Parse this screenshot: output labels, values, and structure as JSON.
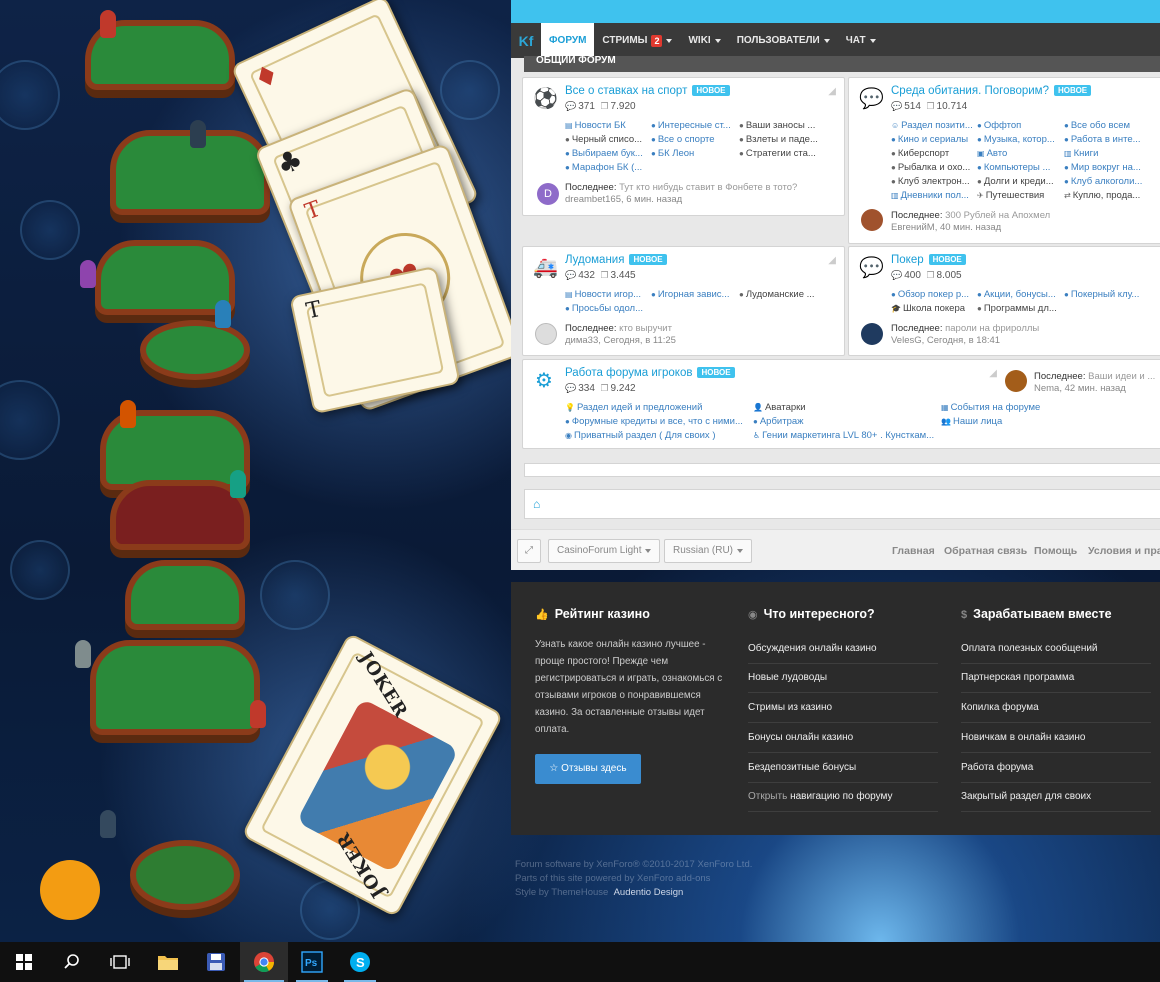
{
  "navbar": {
    "logo": "Kf",
    "items": [
      {
        "label": "ФОРУМ",
        "active": true
      },
      {
        "label": "СТРИМЫ",
        "badge": "2"
      },
      {
        "label": "WIKI"
      },
      {
        "label": "ПОЛЬЗОВАТЕЛИ"
      },
      {
        "label": "ЧАТ"
      }
    ]
  },
  "section_title": "ОБЩИЙ ФОРУМ",
  "new_badge": "НОВОЕ",
  "last_label": "Последнее:",
  "forums": {
    "sport": {
      "title": "Все о ставках на спорт",
      "threads": "371",
      "posts": "7.920",
      "subs": [
        "Новости БК",
        "Интересные ст...",
        "Ваши заносы ...",
        "Черный списо...",
        "Все о спорте",
        "Взлеты и паде...",
        "Выбираем бук...",
        "БК Леон",
        "Стратегии ста...",
        "Марафон БК (..."
      ],
      "last_title": "Тут кто нибудь ставит в Фонбете в тото?",
      "last_meta": "dreambet165, 6 мин. назад",
      "avatar_letter": "D"
    },
    "habitat": {
      "title": "Среда обитания. Поговорим?",
      "threads": "514",
      "posts": "10.714",
      "subs": [
        "Раздел позити...",
        "Оффтоп",
        "Все обо всем",
        "Кино и сериалы",
        "Музыка, котор...",
        "Работа в инте...",
        "Киберспорт",
        "Авто",
        "Книги",
        "Рыбалка и охо...",
        "Компьютеры ...",
        "Мир вокруг на...",
        "Клуб электрон...",
        "Долги и креди...",
        "Клуб алкоголи...",
        "Дневники пол...",
        "Путешествия",
        "Куплю, прода..."
      ],
      "last_title": "300 Рублей на Апохмел",
      "last_meta": "ЕвгенийМ, 40 мин. назад"
    },
    "ludomania": {
      "title": "Лудомания",
      "threads": "432",
      "posts": "3.445",
      "subs": [
        "Новости игор...",
        "Игорная завис...",
        "Лудоманские ...",
        "Просьбы одол..."
      ],
      "last_title": "кто выручит",
      "last_meta": "дима33, Сегодня, в 11:25"
    },
    "poker": {
      "title": "Покер",
      "threads": "400",
      "posts": "8.005",
      "subs": [
        "Обзор покер р...",
        "Акции, бонусы...",
        "Покерный клу...",
        "Школа покера",
        "Программы дл..."
      ],
      "last_title": "пароли на фрироллы",
      "last_meta": "VelesG, Сегодня, в 18:41"
    },
    "work": {
      "title": "Работа форума игроков",
      "threads": "334",
      "posts": "9.242",
      "subs": [
        "Раздел идей и предложений",
        "Аватарки",
        "События на форуме",
        "Форумные кредиты и все, что с ними...",
        "Арбитраж",
        "Наши лица",
        "Приватный раздел ( Для своих )",
        "Гении маркетинга LVL 80+ . Кунсткам..."
      ],
      "last_title": "Ваши идеи и ...",
      "last_meta": "Nema, 42 мин. назад"
    }
  },
  "footer_controls": {
    "style": "CasinoForum Light",
    "language": "Russian (RU)",
    "links": [
      "Главная",
      "Обратная связь",
      "Помощь",
      "Условия и правила"
    ]
  },
  "dark_footer": {
    "col1": {
      "title": "Рейтинг казино",
      "text": "Узнать какое онлайн казино лучшее - проще простого! Прежде чем регистрироваться и играть, ознакомься с отзывами игроков о понравившемся казино. За оставленные отзывы идет оплата.",
      "button": "Отзывы здесь"
    },
    "col2": {
      "title": "Что интересного?",
      "links": [
        "Обсуждения онлайн казино",
        "Новые лудоводы",
        "Стримы из казино",
        "Бонусы онлайн казино",
        "Бездепозитные бонусы"
      ],
      "last_prefix": "Открыть",
      "last_link": "навигацию по форуму"
    },
    "col3": {
      "title": "Зарабатываем вместе",
      "links": [
        "Оплата полезных сообщений",
        "Партнерская программа",
        "Копилка форума",
        "Новичкам в онлайн казино",
        "Работа форума",
        "Закрытый раздел для своих"
      ]
    }
  },
  "credits": {
    "line1": "Forum software by XenForo® ©2010-2017 XenForo Ltd.",
    "line2": "Parts of this site powered by XenForo add-ons",
    "line3": "Style by ThemeHouse",
    "design": "Audentio Design"
  },
  "cards": {
    "joker_label": "JOKER",
    "card_ten": "T"
  },
  "icons": {
    "threads": "speech-bubble-icon",
    "posts": "copy-icon",
    "rss": "rss-icon",
    "home": "home-icon",
    "expand": "expand-icon"
  },
  "colors": {
    "accent": "#1a9ed6",
    "top_strip": "#3fc2ee",
    "navbar": "#3a3a3a",
    "new_badge": "#3fc2ee",
    "dark_footer": "#2b2b2b",
    "footer_button": "#3a8cd0"
  }
}
